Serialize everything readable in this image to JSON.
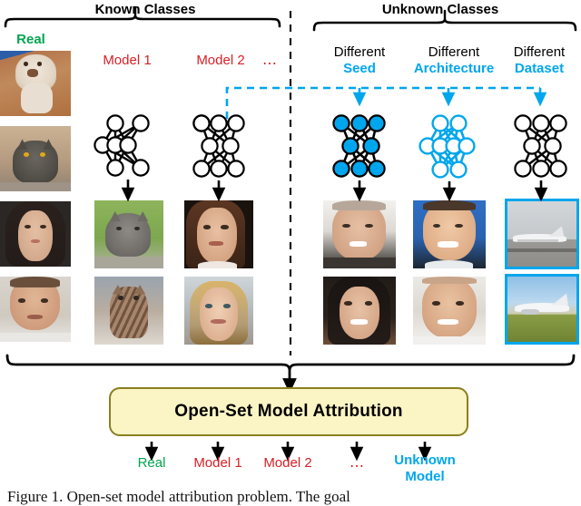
{
  "figure": {
    "caption": "Figure 1.   Open-set model attribution problem.  The goal"
  },
  "groups": {
    "known": {
      "title": "Known Classes"
    },
    "unknown": {
      "title": "Unknown Classes"
    }
  },
  "columns": [
    {
      "id": "real",
      "label_top": "Real",
      "label_bottom": "",
      "color": "#00a64f",
      "kind": "real"
    },
    {
      "id": "model1",
      "label_top": "Model 1",
      "label_bottom": "",
      "color": "#d81f26",
      "kind": "known"
    },
    {
      "id": "model2",
      "label_top": "Model 2",
      "label_bottom": "",
      "color": "#d81f26",
      "kind": "known"
    },
    {
      "id": "ellipsis",
      "label_top": "⋯",
      "label_bottom": "",
      "color": "#d81f26",
      "kind": "ellipsis"
    },
    {
      "id": "seed",
      "label_top": "Different",
      "label_bottom": "Seed",
      "color": "#00a6ed",
      "kind": "unknown"
    },
    {
      "id": "architecture",
      "label_top": "Different",
      "label_bottom": "Architecture",
      "color": "#00a6ed",
      "kind": "unknown"
    },
    {
      "id": "dataset",
      "label_top": "Different",
      "label_bottom": "Dataset",
      "color": "#00a6ed",
      "kind": "unknown"
    }
  ],
  "networks": [
    {
      "id": "net-model1",
      "layers": [
        2,
        3,
        2
      ],
      "style": "black-outline"
    },
    {
      "id": "net-model2",
      "layers": [
        3,
        2,
        3
      ],
      "style": "black-outline"
    },
    {
      "id": "net-seed",
      "layers": [
        3,
        2,
        3
      ],
      "style": "cyan-filled"
    },
    {
      "id": "net-architecture",
      "layers": [
        2,
        4,
        2
      ],
      "style": "cyan-outline"
    },
    {
      "id": "net-dataset",
      "layers": [
        3,
        2,
        3
      ],
      "style": "black-outline"
    }
  ],
  "samples": {
    "real": [
      "real-cat-cream-photo",
      "real-cat-gray-photo",
      "real-face-woman-photo",
      "real-face-man-photo"
    ],
    "model1": [
      "generated-cat-gray-garden",
      "generated-cat-tabby-kitten"
    ],
    "model2": [
      "generated-face-young-man",
      "generated-face-blonde-woman"
    ],
    "seed": [
      "generated-face-older-man",
      "generated-face-dark-hair-woman"
    ],
    "architecture": [
      "generated-face-smiling-man-blue",
      "generated-face-bald-man"
    ],
    "dataset": [
      "generated-airplane-parked",
      "generated-airplane-taxiing"
    ]
  },
  "attribution": {
    "box_label": "Open-Set Model Attribution"
  },
  "outputs": [
    {
      "label": "Real",
      "sub": "",
      "color": "#00a64f",
      "bold": false
    },
    {
      "label": "Model 1",
      "sub": "",
      "color": "#d81f26",
      "bold": false
    },
    {
      "label": "Model 2",
      "sub": "",
      "color": "#d81f26",
      "bold": false
    },
    {
      "label": "⋯",
      "sub": "",
      "color": "#d81f26",
      "bold": false
    },
    {
      "label": "Unknown",
      "sub": "Model",
      "color": "#00a6ed",
      "bold": true
    }
  ],
  "colors": {
    "red": "#d81f26",
    "green": "#00a64f",
    "cyan": "#00a6ed",
    "black": "#000000",
    "box_fill": "#fbf4c4",
    "box_stroke": "#8a7f20"
  }
}
